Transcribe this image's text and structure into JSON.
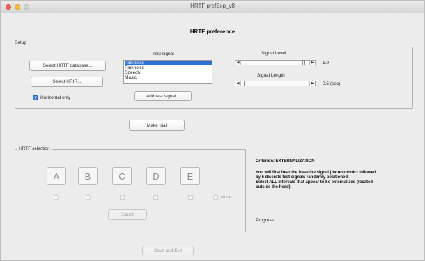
{
  "window": {
    "title": "HRTF prefExp_v8"
  },
  "main_title": "HRTF preference",
  "setup": {
    "label": "Setup",
    "select_database_label": "Select HRTF database...",
    "select_hrtf_label": "Select HRIR...",
    "horizontal_only_label": "Horizontal only",
    "horizontal_only_checked": true,
    "test_signal": {
      "label": "Test signal",
      "options": [
        "Pinknoise",
        "Pinknoise",
        "Speech",
        "Music"
      ],
      "selected_index": 0,
      "add_button_label": "Add test signal..."
    },
    "signal_level": {
      "label": "Signal Level",
      "value": "1.0",
      "fraction": 0.95
    },
    "signal_length": {
      "label": "Signal Length",
      "value": "0.5 (sec)",
      "fraction": 0.05
    }
  },
  "make_trial_label": "Make trial",
  "hrtf_selection": {
    "label": "HRTF selection",
    "buttons": [
      "A",
      "B",
      "C",
      "D",
      "E"
    ],
    "none_label": "None",
    "submit_label": "Submit"
  },
  "criterion": {
    "title": "Criterion: EXTERNALIZATION",
    "line1": "You will first hear the baseline signal (monophonic) followed",
    "line2": "by 5 discrete test signals randomly positioned.",
    "line3": "Select ALL intervals that appear to be externalized (located",
    "line4": "outside the head)."
  },
  "progress_label": "Progress",
  "save_exit_label": "Save and Exit",
  "colors": {
    "accent": "#2f6fd6",
    "close": "#f4615a",
    "minimize": "#f7bd3c"
  }
}
